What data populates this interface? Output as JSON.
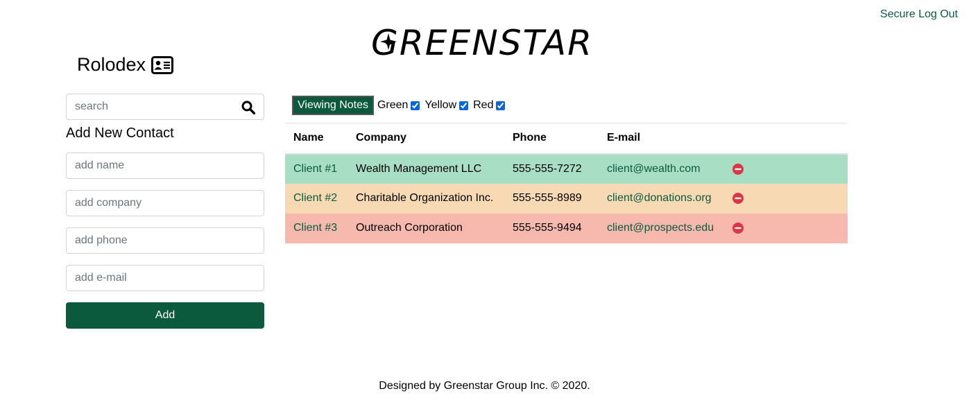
{
  "header": {
    "logout_label": "Secure Log Out",
    "logo_text": "GREENSTAR"
  },
  "sidebar": {
    "title": "Rolodex",
    "title_icon": "address-card-icon",
    "search_placeholder": "search",
    "add_title": "Add New Contact",
    "name_placeholder": "add name",
    "company_placeholder": "add company",
    "phone_placeholder": "add phone",
    "email_placeholder": "add e-mail",
    "add_label": "Add"
  },
  "filters": {
    "view_label": "Viewing Notes",
    "items": [
      {
        "label": "Green",
        "checked": true
      },
      {
        "label": "Yellow",
        "checked": true
      },
      {
        "label": "Red",
        "checked": true
      }
    ]
  },
  "table": {
    "columns": [
      "Name",
      "Company",
      "Phone",
      "E-mail"
    ],
    "rows": [
      {
        "name": "Client #1",
        "company": "Wealth Management LLC",
        "phone": "555-555-7272",
        "email": "client@wealth.com",
        "status": "green"
      },
      {
        "name": "Client #2",
        "company": "Charitable Organization Inc.",
        "phone": "555-555-8989",
        "email": "client@donations.org",
        "status": "yellow"
      },
      {
        "name": "Client #3",
        "company": "Outreach Corporation",
        "phone": "555-555-9494",
        "email": "client@prospects.edu",
        "status": "red"
      }
    ]
  },
  "footer": {
    "text": "Designed by Greenstar Group Inc. © 2020."
  },
  "colors": {
    "brand": "#0b5a3e",
    "row_green": "#a8dfc4",
    "row_yellow": "#f7d9b4",
    "row_red": "#f7b9ad",
    "remove": "#dc3545"
  }
}
